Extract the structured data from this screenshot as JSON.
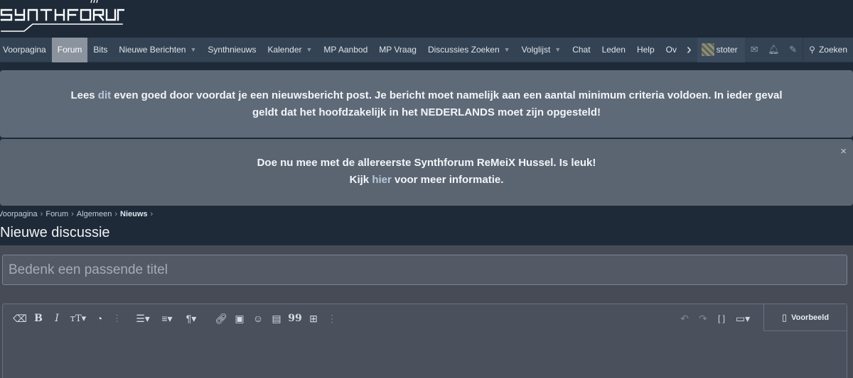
{
  "logo": {
    "text": "SYNTHFORUM"
  },
  "nav": {
    "items": [
      {
        "label": "Voorpagina",
        "active": false,
        "dropdown": false
      },
      {
        "label": "Forum",
        "active": true,
        "dropdown": false
      },
      {
        "label": "Bits",
        "active": false,
        "dropdown": false
      },
      {
        "label": "Nieuwe Berichten",
        "active": false,
        "dropdown": true
      },
      {
        "label": "Synthnieuws",
        "active": false,
        "dropdown": false
      },
      {
        "label": "Kalender",
        "active": false,
        "dropdown": true
      },
      {
        "label": "MP Aanbod",
        "active": false,
        "dropdown": false
      },
      {
        "label": "MP Vraag",
        "active": false,
        "dropdown": false
      },
      {
        "label": "Discussies Zoeken",
        "active": false,
        "dropdown": true
      },
      {
        "label": "Volglijst",
        "active": false,
        "dropdown": true
      },
      {
        "label": "Chat",
        "active": false,
        "dropdown": false
      },
      {
        "label": "Leden",
        "active": false,
        "dropdown": false
      },
      {
        "label": "Help",
        "active": false,
        "dropdown": false
      },
      {
        "label": "Ov",
        "active": false,
        "dropdown": false
      }
    ],
    "more_icon": "chevron-right-icon",
    "user": {
      "name": "stoter"
    },
    "icons": [
      "envelope-icon",
      "bell-icon",
      "brush-icon"
    ],
    "search_label": "Zoeken"
  },
  "notice1": {
    "part1": "Lees ",
    "link": "dit",
    "part2": " even goed door voordat je een nieuwsbericht post. Je bericht moet namelijk aan een aantal minimum criteria voldoen. In ieder geval",
    "line2": "geldt dat het hoofdzakelijk in het NEDERLANDS moet zijn opgesteld!"
  },
  "notice2": {
    "line1": "Doe nu mee met de allereerste Synthforum ReMeiX Hussel. Is leuk!",
    "part1": "Kijk ",
    "link": "hier",
    "part2": " voor meer informatie.",
    "close": "×"
  },
  "breadcrumb": {
    "items": [
      "Voorpagina",
      "Forum",
      "Algemeen"
    ],
    "current": "Nieuws",
    "sep": "›"
  },
  "page_title": "Nieuwe discussie",
  "title_input": {
    "placeholder": "Bedenk een passende titel",
    "value": ""
  },
  "editor": {
    "preview_label": "Voorbeeld"
  },
  "colors": {
    "background": "#1e2a38",
    "navbar": "#344354",
    "active_tab": "#8a939e",
    "notice": "#5e6a78",
    "link": "#b8c7d9"
  }
}
